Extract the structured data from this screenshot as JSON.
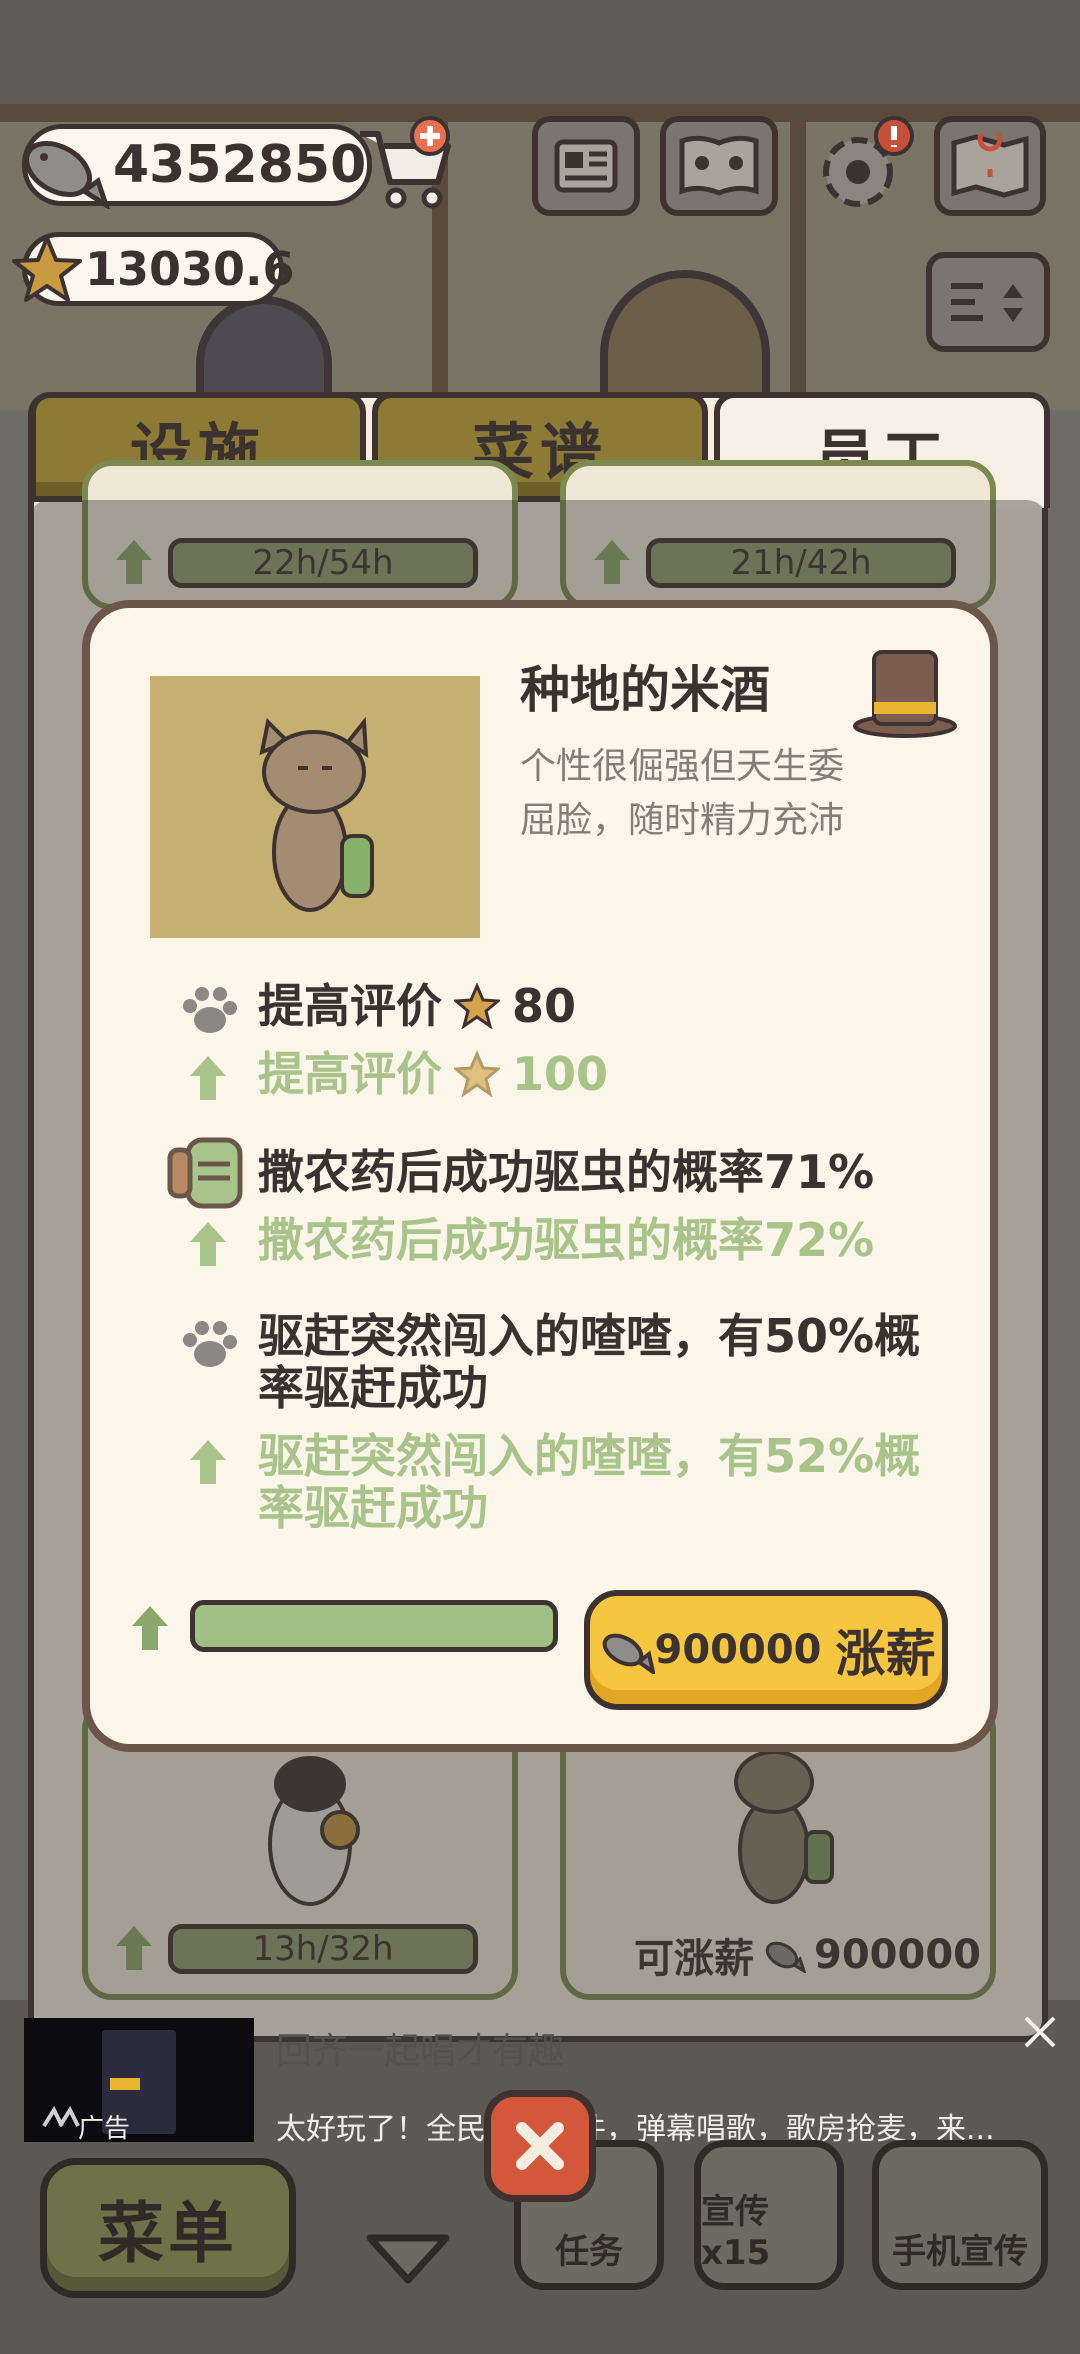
{
  "resources": {
    "fish": "4352850",
    "stars": "13030.6"
  },
  "tabs": [
    {
      "label": "设施",
      "active": false
    },
    {
      "label": "菜谱",
      "active": false
    },
    {
      "label": "员工",
      "active": true
    }
  ],
  "staff_cards": {
    "top_left_timer": "22h/54h",
    "top_right_timer": "21h/42h",
    "bottom_left_timer": "13h/32h",
    "bottom_right_raise_label": "可涨薪",
    "bottom_right_raise_cost": "900000"
  },
  "modal": {
    "name": "种地的米酒",
    "description": "个性很倔强但天生委屈脸，随时精力充沛",
    "skills": [
      {
        "current": "提高评价",
        "current_value": "80",
        "next": "提高评价",
        "next_value": "100"
      },
      {
        "current": "撒农药后成功驱虫的概率71%",
        "next": "撒农药后成功驱虫的概率72%"
      },
      {
        "current_line1": "驱赶突然闯入的喳喳，有50%概",
        "current_line2": "率驱赶成功",
        "next_line1": "驱赶突然闯入的喳喳，有52%概",
        "next_line2": "率驱赶成功"
      }
    ],
    "progress": 1.0,
    "raise_cost": "900000",
    "raise_label": "涨薪"
  },
  "ad": {
    "label": "广告",
    "faded_text": "回齐一起唱才有趣",
    "text": "太好玩了！全民唱歌软件，弹幕唱歌，歌房抢麦，来..."
  },
  "bottom_nav": {
    "menu": "菜单",
    "task": "任务",
    "promote": "宣传x15",
    "phone_promote": "手机宣传"
  },
  "colors": {
    "accent_yellow": "#f6c640",
    "next_level_green": "#a8c48b",
    "tab_gold": "#8c7a35"
  }
}
